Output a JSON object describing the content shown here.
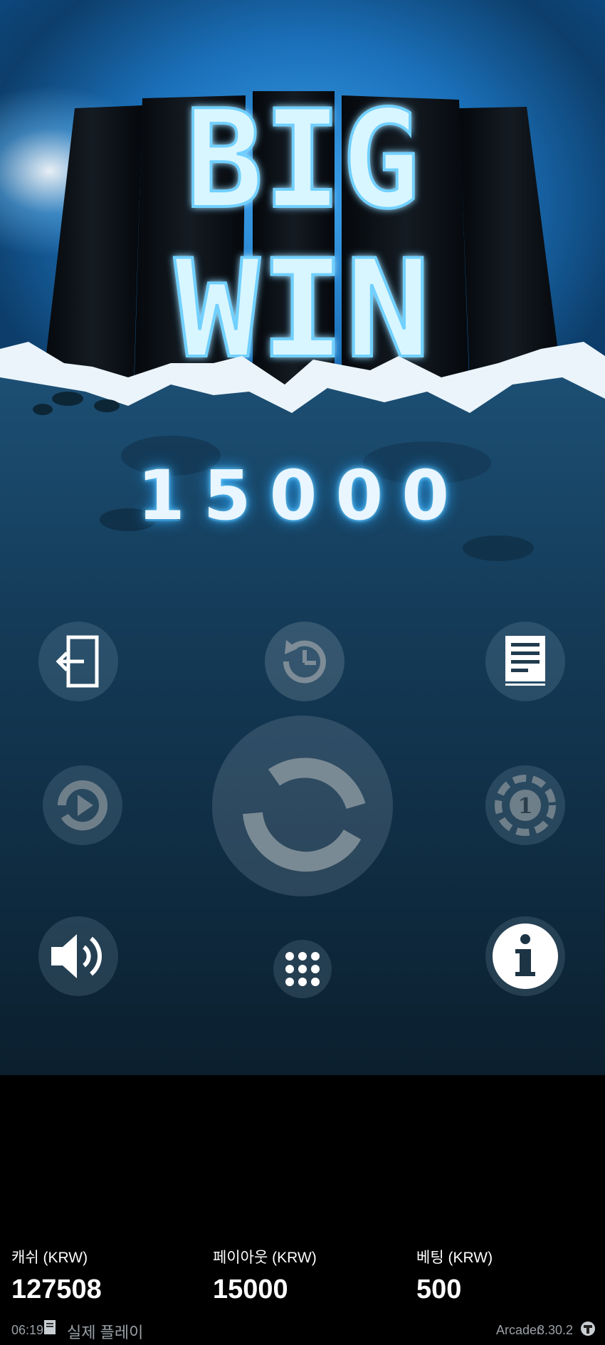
{
  "game": {
    "banner_line1": "BIG",
    "banner_line2": "WIN",
    "win_amount": "15000"
  },
  "controls": [
    {
      "name": "exit",
      "icon": "exit-icon"
    },
    {
      "name": "history",
      "icon": "history-clock-icon"
    },
    {
      "name": "paytable",
      "icon": "document-icon"
    },
    {
      "name": "autoplay",
      "icon": "autoplay-icon"
    },
    {
      "name": "spin",
      "icon": "spin-icon"
    },
    {
      "name": "bet-settings",
      "icon": "chip-icon"
    },
    {
      "name": "sound",
      "icon": "speaker-icon"
    },
    {
      "name": "menu",
      "icon": "grid-menu-icon"
    },
    {
      "name": "info",
      "icon": "info-icon"
    }
  ],
  "hud": {
    "cash_label": "캐쉬 (KRW)",
    "cash_value": "127508",
    "payout_label": "페이아웃 (KRW)",
    "payout_value": "15000",
    "bet_label": "베팅 (KRW)",
    "bet_value": "500"
  },
  "status": {
    "time": "06:19",
    "mode": "실제 플레이",
    "brand": "Arcader",
    "version": "3.30.2"
  },
  "colors": {
    "accent": "#3ea3ee",
    "glow": "#bff0ff",
    "hud_background": "#000000"
  }
}
